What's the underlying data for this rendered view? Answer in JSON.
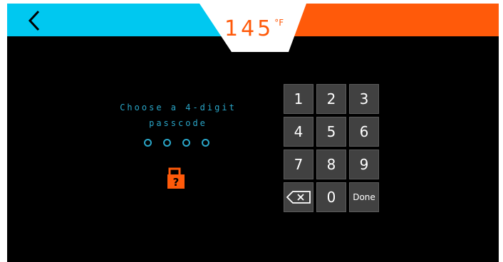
{
  "header": {
    "back_icon": "chevron-left-icon",
    "temperature_value": "145",
    "temperature_unit": "°F",
    "colors": {
      "left": "#00c8f0",
      "right": "#ff5a0a",
      "badge": "#ffffff"
    }
  },
  "passcode": {
    "prompt_line1": "Choose a 4-digit",
    "prompt_line2": "passcode",
    "digits_entered": 0,
    "digits_total": 4,
    "lock_icon": "lock-question-icon"
  },
  "keypad": {
    "k1": "1",
    "k2": "2",
    "k3": "3",
    "k4": "4",
    "k5": "5",
    "k6": "6",
    "k7": "7",
    "k8": "8",
    "k9": "9",
    "backspace_icon": "backspace-icon",
    "k0": "0",
    "done": "Done"
  }
}
